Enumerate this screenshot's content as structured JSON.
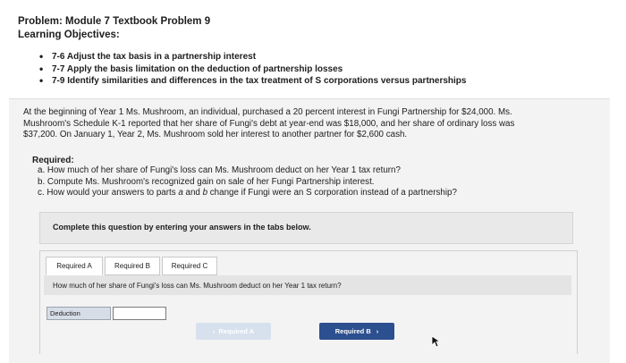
{
  "header": {
    "problem": "Problem: Module 7 Textbook Problem 9",
    "objectives_title": "Learning Objectives:"
  },
  "objectives": [
    "7-6 Adjust the tax basis in a partnership interest",
    "7-7 Apply the basis limitation on the deduction of partnership losses",
    "7-9 Identify similarities and differences in the tax treatment of S corporations versus partnerships"
  ],
  "problem_text": {
    "line1": "At the beginning of Year 1 Ms. Mushroom, an individual, purchased a 20 percent interest in Fungi Partnership for $24,000. Ms.",
    "line2": "Mushroom's Schedule K-1 reported that her share of Fungi's debt at year-end was $18,000, and her share of ordinary loss was",
    "line3": "$37,200. On January 1, Year 2, Ms. Mushroom sold her interest to another partner for $2,600 cash."
  },
  "required": {
    "heading": "Required:",
    "a": "a. How much of her share of Fungi's loss can Ms. Mushroom deduct on her Year 1 tax return?",
    "b": "b. Compute Ms. Mushroom's recognized gain on sale of her Fungi Partnership interest.",
    "c_prefix": "c. How would your answers to parts ",
    "c_a": "a",
    "c_and": " and ",
    "c_b": "b",
    "c_suffix": " change if Fungi were an S corporation instead of a partnership?"
  },
  "instruction": "Complete this question by entering your answers in the tabs below.",
  "tabs": [
    {
      "label": "Required A"
    },
    {
      "label": "Required B"
    },
    {
      "label": "Required C"
    }
  ],
  "tab_content": {
    "question": "How much of her share of Fungi's loss can Ms. Mushroom deduct on her Year 1 tax return?",
    "field_label": "Deduction",
    "field_value": ""
  },
  "nav": {
    "prev_label": "Required A",
    "next_label": "Required B",
    "prev_icon": "chevron-left-icon",
    "next_icon": "chevron-right-icon"
  },
  "colors": {
    "next_button": "#2c4f8f",
    "prev_button_disabled": "#d7e1ee"
  }
}
